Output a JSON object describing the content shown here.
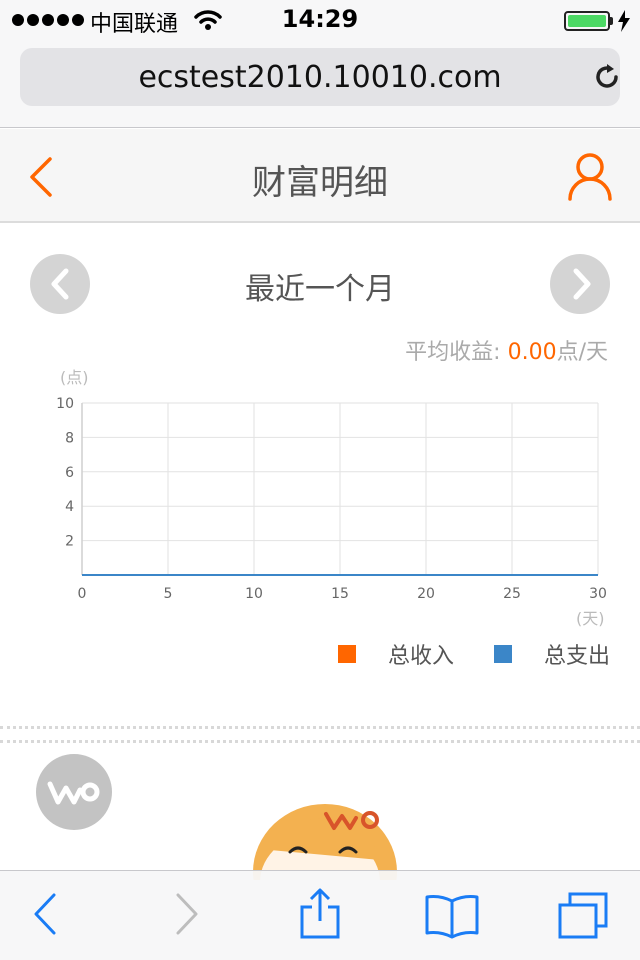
{
  "status_bar": {
    "carrier": "中国联通",
    "time": "14:29",
    "battery_color": "#4cd964"
  },
  "browser": {
    "url": "ecstest2010.10010.com",
    "reload_icon": "reload-icon"
  },
  "header": {
    "title": "财富明细",
    "back_icon": "chevron-left-icon",
    "user_icon": "user-icon"
  },
  "period": {
    "title": "最近一个月",
    "prev_icon": "chevron-left-icon",
    "next_icon": "chevron-right-icon"
  },
  "summary": {
    "avg_label": "平均收益:",
    "avg_value": "0.00",
    "avg_unit": "点/天"
  },
  "chart_data": {
    "type": "line",
    "y_unit": "(点)",
    "x_unit": "(天)",
    "x_ticks": [
      "0",
      "5",
      "10",
      "15",
      "20",
      "25",
      "30"
    ],
    "y_ticks": [
      "2",
      "4",
      "6",
      "8",
      "10"
    ],
    "xlim": [
      0,
      30
    ],
    "ylim": [
      0,
      10
    ],
    "grid": true,
    "series": [
      {
        "name": "总收入",
        "color": "#ff6600",
        "x": [
          0,
          30
        ],
        "y": [
          0,
          0
        ]
      },
      {
        "name": "总支出",
        "color": "#3b86c8",
        "x": [
          0,
          30
        ],
        "y": [
          0,
          0
        ]
      }
    ]
  },
  "accent_color": "#ff6600"
}
